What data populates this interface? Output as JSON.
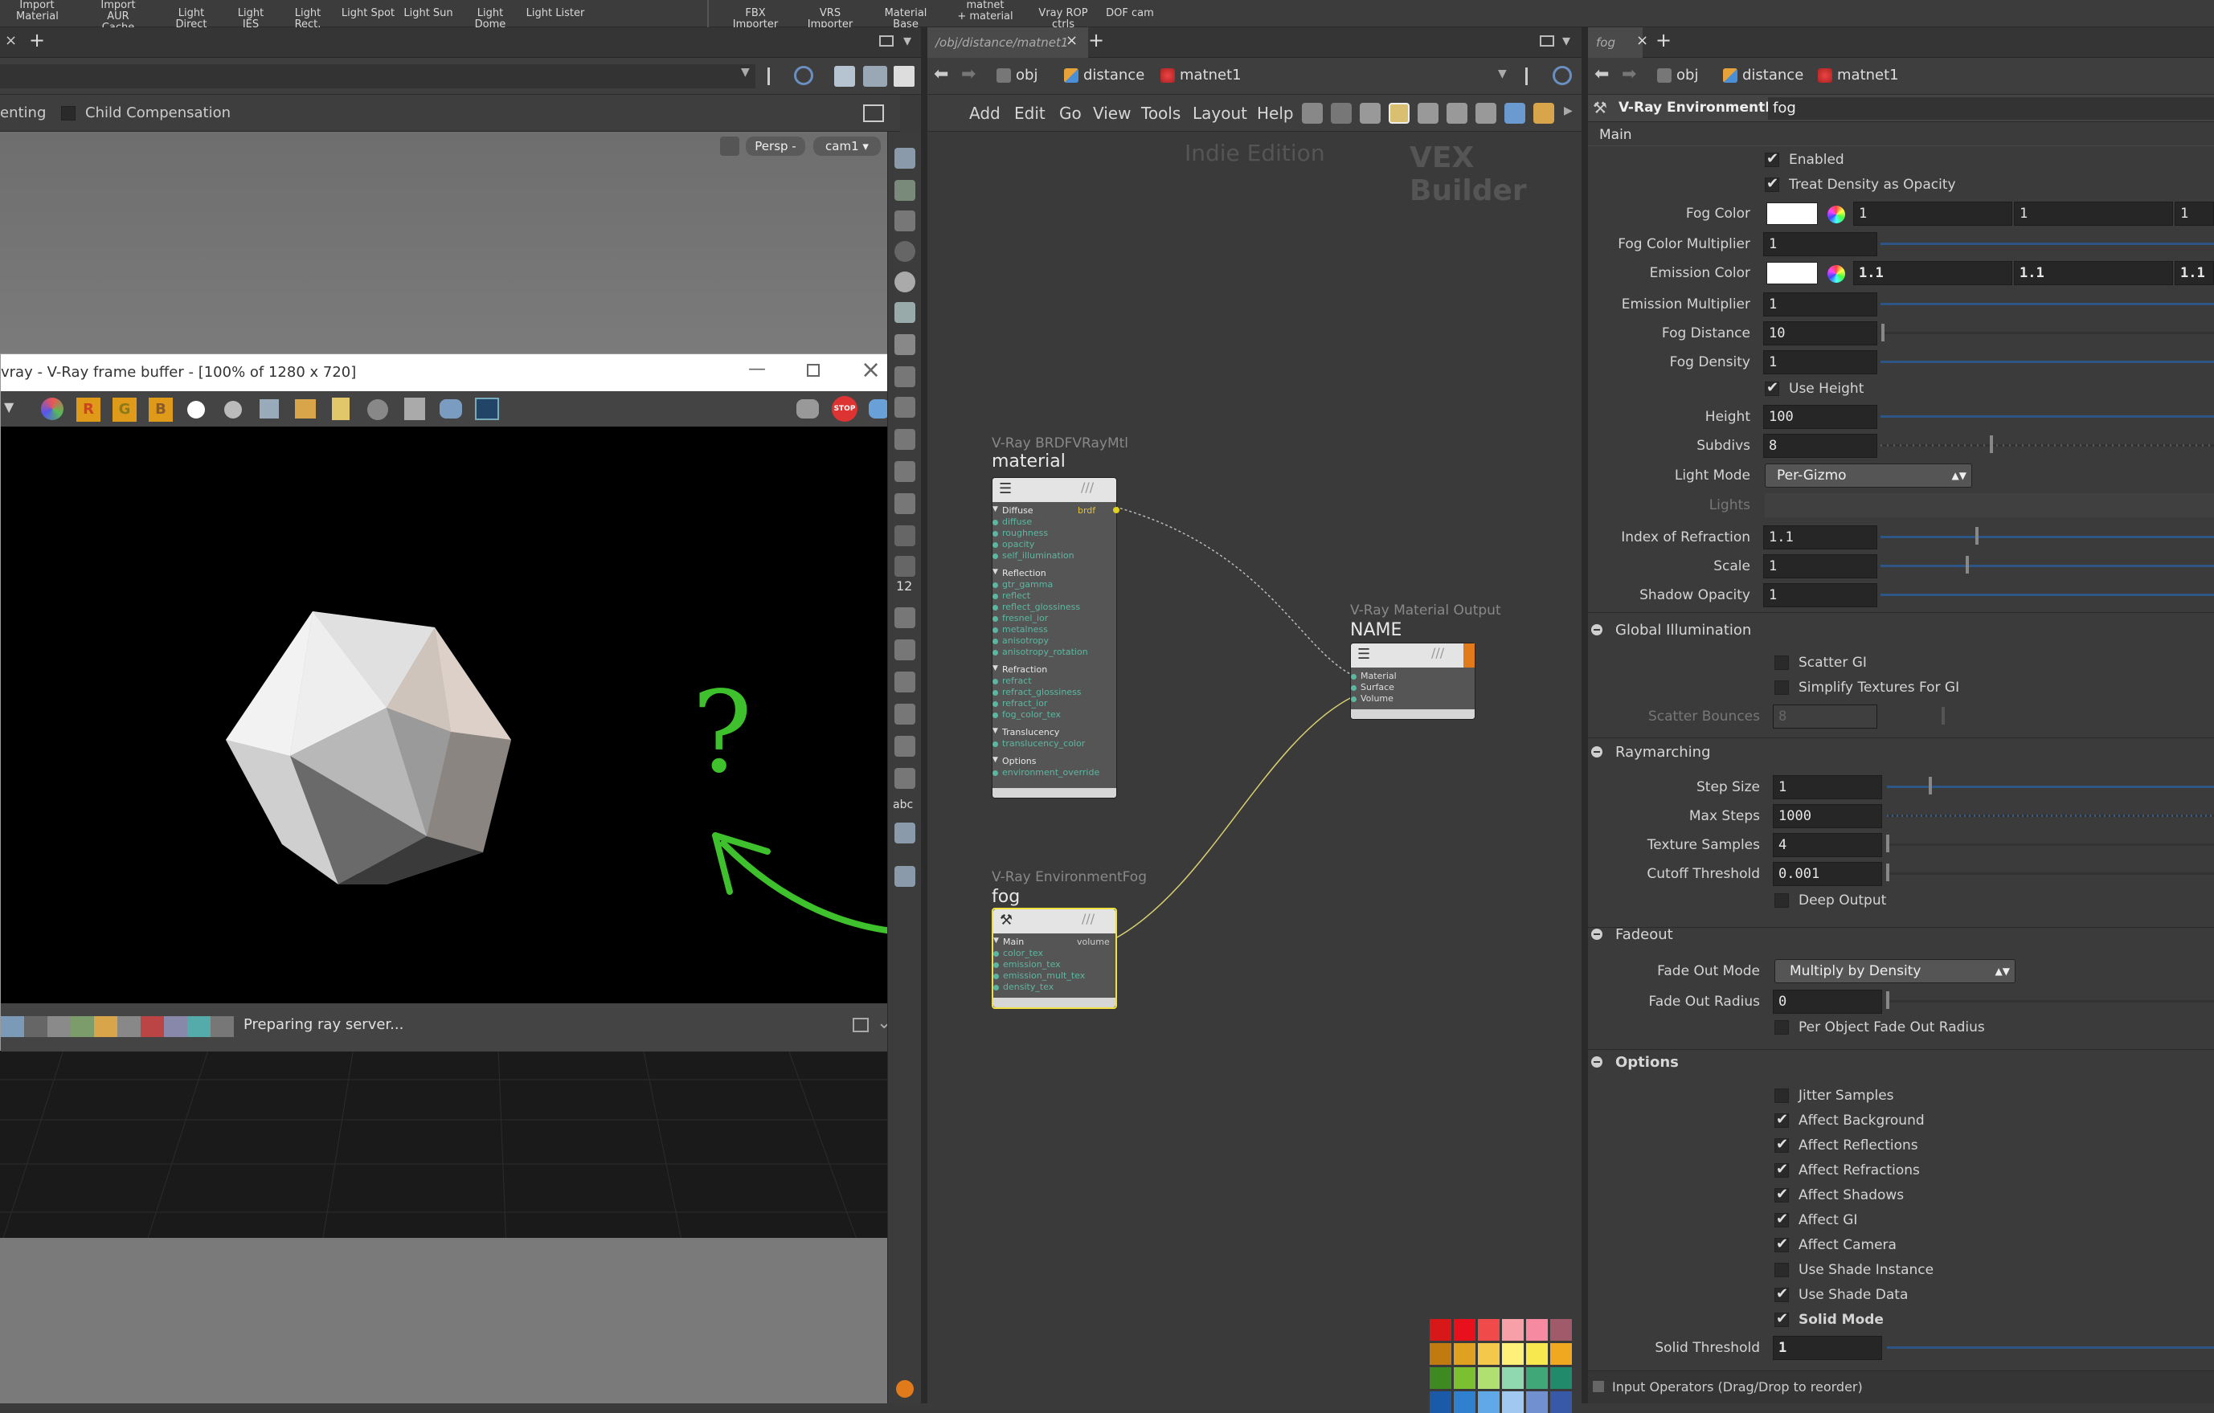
{
  "shelf": {
    "items": [
      {
        "line1": "Import",
        "line2": "Material"
      },
      {
        "line1": "Import",
        "line2": "AUR Cache"
      },
      {
        "line1": "",
        "line2": "Light Direct"
      },
      {
        "line1": "",
        "line2": "Light IES"
      },
      {
        "line1": "",
        "line2": "Light Rect."
      },
      {
        "line1": "",
        "line2": "Light Spot"
      },
      {
        "line1": "",
        "line2": "Light Sun"
      },
      {
        "line1": "",
        "line2": "Light Dome"
      },
      {
        "line1": "",
        "line2": "Light Lister"
      },
      {
        "line1": "",
        "line2": "FBX Importer"
      },
      {
        "line1": "",
        "line2": "VRS Importer"
      },
      {
        "line1": "",
        "line2": "Material Base"
      },
      {
        "line1": "matnet",
        "line2": "+ material"
      },
      {
        "line1": "",
        "line2": "Vray ROP ctrls"
      },
      {
        "line1": "",
        "line2": "DOF cam"
      }
    ]
  },
  "left": {
    "toolbar_text1": "enting",
    "child_compensation": "Child Compensation",
    "persp": "Persp -",
    "cam": "cam1",
    "frame_buffer_title": "vray - V-Ray frame buffer - [100% of 1280 x 720]",
    "channel_r": "R",
    "channel_g": "G",
    "channel_b": "B",
    "stop": "STOP",
    "status": "Preparing ray server...",
    "annotation": "?"
  },
  "right_tools": {
    "num12": "12",
    "abc": "abc"
  },
  "network": {
    "tab_path": "/obj/distance/matnet1",
    "crumbs": [
      "obj",
      "distance",
      "matnet1"
    ],
    "menu": [
      "Add",
      "Edit",
      "Go",
      "View",
      "Tools",
      "Layout",
      "Help"
    ],
    "watermark": "Indie Edition",
    "context": "VEX Builder",
    "material_node": {
      "type": "V-Ray BRDFVRayMtl",
      "name": "material",
      "output": "brdf",
      "groups": [
        {
          "name": "Diffuse",
          "ports": [
            "diffuse",
            "roughness",
            "opacity",
            "self_illumination"
          ]
        },
        {
          "name": "Reflection",
          "ports": [
            "gtr_gamma",
            "reflect",
            "reflect_glossiness",
            "fresnel_ior",
            "metalness",
            "anisotropy",
            "anisotropy_rotation"
          ]
        },
        {
          "name": "Refraction",
          "ports": [
            "refract",
            "refract_glossiness",
            "refract_ior",
            "fog_color_tex"
          ]
        },
        {
          "name": "Translucency",
          "ports": [
            "translucency_color"
          ]
        },
        {
          "name": "Options",
          "ports": [
            "environment_override"
          ]
        }
      ]
    },
    "output_node": {
      "type": "V-Ray Material Output",
      "name": "NAME",
      "ports": [
        "Material",
        "Surface",
        "Volume"
      ]
    },
    "fog_node": {
      "type": "V-Ray EnvironmentFog",
      "name": "fog",
      "group": "Main",
      "output": "volume",
      "ports": [
        "color_tex",
        "emission_tex",
        "emission_mult_tex",
        "density_tex"
      ]
    },
    "palette": [
      "#d81818",
      "#e8101c",
      "#f04a4a",
      "#f7a0a8",
      "#f58aa0",
      "#a05a6a",
      "#c07a10",
      "#e0a020",
      "#f4c84a",
      "#fff07a",
      "#f8e850",
      "#f0a820",
      "#3e8a20",
      "#7ac030",
      "#b0e070",
      "#90d8b0",
      "#40a878",
      "#208a6a",
      "#1a5aa8",
      "#3080d0",
      "#60a8e8",
      "#a0c8f0",
      "#7090d0",
      "#3858a8"
    ]
  },
  "params": {
    "tab": "fog",
    "crumbs": [
      "obj",
      "distance",
      "matnet1"
    ],
    "node_type": "V-Ray EnvironmentFog",
    "node_name": "fog",
    "folder": "Main",
    "enabled": "Enabled",
    "treat_density": "Treat Density as Opacity",
    "fog_color_label": "Fog Color",
    "fog_color": [
      "1",
      "1",
      "1"
    ],
    "fog_color_mult_label": "Fog Color Multiplier",
    "fog_color_mult": "1",
    "emission_color_label": "Emission Color",
    "emission_color": [
      "1.1",
      "1.1",
      "1.1"
    ],
    "emission_mult_label": "Emission Multiplier",
    "emission_mult": "1",
    "fog_distance_label": "Fog Distance",
    "fog_distance": "10",
    "fog_density_label": "Fog Density",
    "fog_density": "1",
    "use_height": "Use Height",
    "height_label": "Height",
    "height": "100",
    "subdivs_label": "Subdivs",
    "subdivs": "8",
    "light_mode_label": "Light Mode",
    "light_mode": "Per-Gizmo",
    "lights_label": "Lights",
    "ior_label": "Index of Refraction",
    "ior": "1.1",
    "scale_label": "Scale",
    "scale": "1",
    "shadow_opacity_label": "Shadow Opacity",
    "shadow_opacity": "1",
    "gi_section": "Global Illumination",
    "scatter_gi": "Scatter GI",
    "simplify_textures": "Simplify Textures For GI",
    "scatter_bounces_label": "Scatter Bounces",
    "scatter_bounces": "8",
    "raymarching_section": "Raymarching",
    "step_size_label": "Step Size",
    "step_size": "1",
    "max_steps_label": "Max Steps",
    "max_steps": "1000",
    "texture_samples_label": "Texture Samples",
    "texture_samples": "4",
    "cutoff_label": "Cutoff Threshold",
    "cutoff": "0.001",
    "deep_output": "Deep Output",
    "fadeout_section": "Fadeout",
    "fade_mode_label": "Fade Out Mode",
    "fade_mode": "Multiply by Density",
    "fade_radius_label": "Fade Out Radius",
    "fade_radius": "0",
    "per_object_fade": "Per Object Fade Out Radius",
    "options_section": "Options",
    "jitter": "Jitter Samples",
    "affect_background": "Affect Background",
    "affect_reflections": "Affect Reflections",
    "affect_refractions": "Affect Refractions",
    "affect_shadows": "Affect Shadows",
    "affect_gi": "Affect GI",
    "affect_camera": "Affect Camera",
    "use_shade_instance": "Use Shade Instance",
    "use_shade_data": "Use Shade Data",
    "solid_mode": "Solid Mode",
    "solid_threshold_label": "Solid Threshold",
    "solid_threshold": "1",
    "input_operators": "Input Operators (Drag/Drop to reorder)"
  }
}
